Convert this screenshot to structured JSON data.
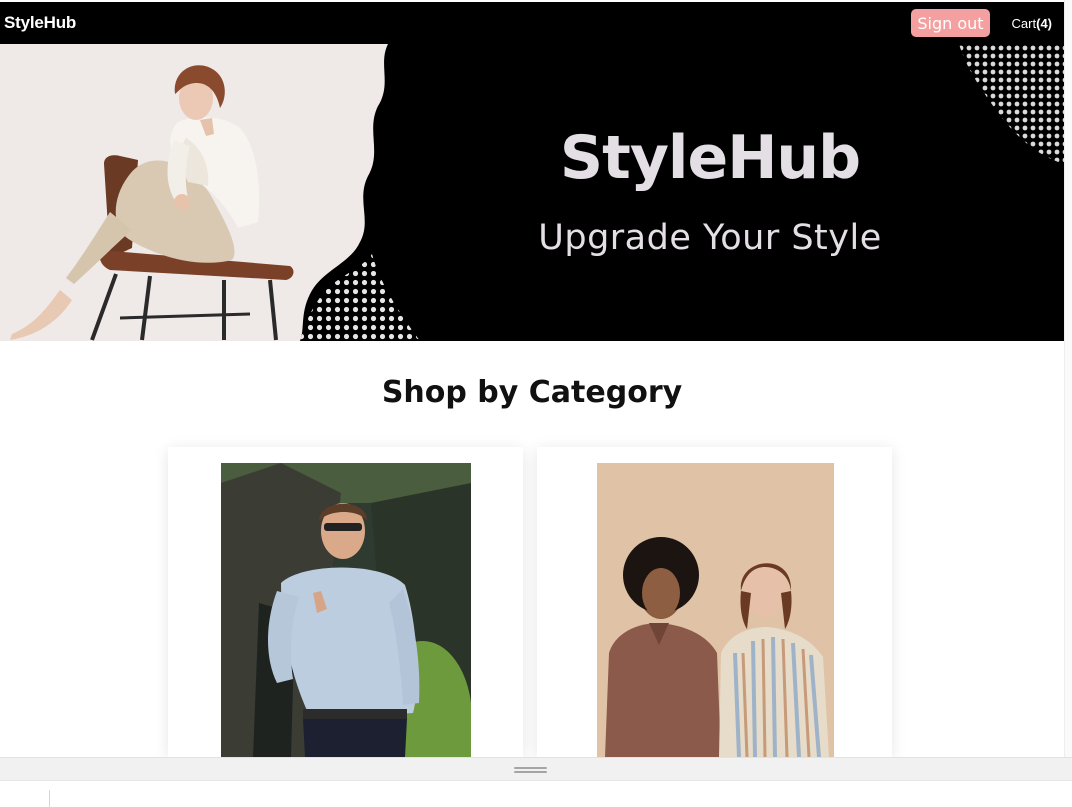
{
  "navbar": {
    "brand": "StyleHub",
    "sign_out_label": "Sign out",
    "cart_label": "Cart",
    "cart_count": "(4)"
  },
  "hero": {
    "title": "StyleHub",
    "tagline": "Upgrade Your Style"
  },
  "categories": {
    "heading": "Shop by Category",
    "cards": [
      {
        "name": "men-category"
      },
      {
        "name": "women-category"
      }
    ]
  },
  "colors": {
    "navbar_bg": "#000000",
    "sign_out_bg": "#f4a0a0",
    "hero_bg": "#000000",
    "hero_text": "#e3dfe4"
  }
}
